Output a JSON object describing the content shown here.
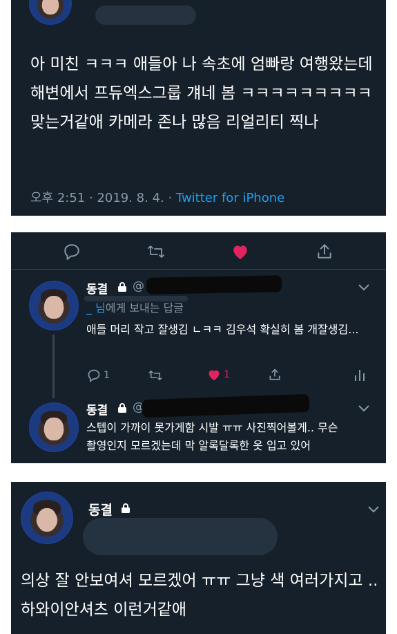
{
  "tweet1": {
    "text": "아 미친 ㅋㅋㅋ 애들아 나 속초에 엄빠랑 여행왔는데 해변에서 프듀엑스그룹 걔네 봄 ㅋㅋㅋㅋㅋㅋㅋㅋㅋ 맞는거같애 카메라 존나 많음 리얼리티 찍나",
    "time": "오후 2:51 · 2019. 8. 4. · ",
    "source": "Twitter for iPhone"
  },
  "actions": {
    "reply_icon": "reply-icon",
    "retweet_icon": "retweet-icon",
    "like_icon": "heart-filled-icon",
    "share_icon": "share-icon",
    "like_color": "#e0245e"
  },
  "reply1": {
    "name": "동결",
    "handle": "@",
    "reply_to_mention": "_ 님",
    "reply_to_suffix": "에게 보내는 답글",
    "text": "애들 머리 작고 잘생김 ㄴㅋㅋ 김우석 확실히 봄 개잘생김...",
    "reply_count": "1",
    "like_count": "1"
  },
  "reply2": {
    "name": "동결",
    "handle": "@",
    "text": "스텝이 가까이 못가게함 시발 ㅠㅠ 사진찍어볼게.. 무슨 촬영인지 모르겠는데 막 알록달록한 옷 입고 있어"
  },
  "tweet3": {
    "name": "동결",
    "text": "의상 잘 안보여셔 모르겠어 ㅠㅠ 그냥 색 여러가지고 .. 하와이안셔츠 이런거같애"
  },
  "colors": {
    "background": "#15202b",
    "accent": "#1da1f2",
    "muted": "#8899a6"
  }
}
